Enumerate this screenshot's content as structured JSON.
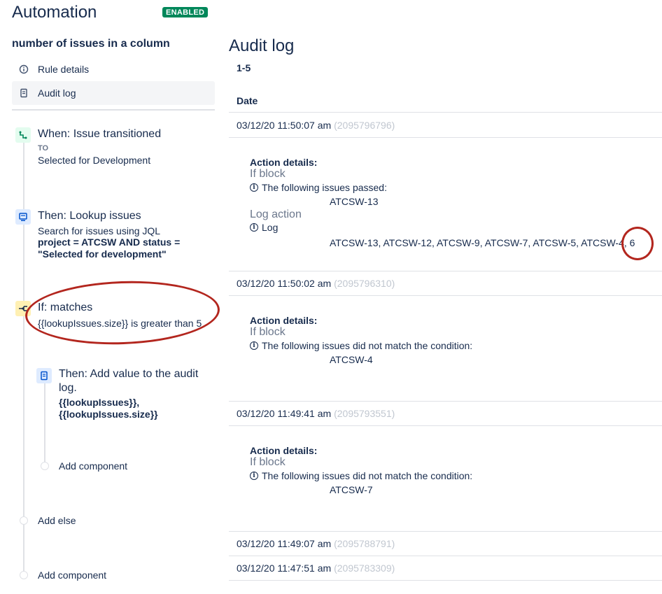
{
  "header": {
    "title": "Automation",
    "status_badge": "ENABLED"
  },
  "sidebar": {
    "rule_name": "number of issues in a column",
    "nav": [
      {
        "label": "Rule details",
        "icon": "info-icon"
      },
      {
        "label": "Audit log",
        "icon": "document-icon",
        "selected": true
      }
    ],
    "components": {
      "trigger": {
        "title": "When: Issue transitioned",
        "to_label": "TO",
        "to_value": "Selected for Development"
      },
      "lookup": {
        "title": "Then: Lookup issues",
        "sub": "Search for issues using JQL",
        "jql": "project = ATCSW AND status = \"Selected for development\""
      },
      "condition": {
        "title": "If: matches",
        "sub": "{{lookupIssues.size}} is greater than 5"
      },
      "log_action": {
        "title": "Then: Add value to the audit log.",
        "value": "{{lookupIssues}}, {{lookupIssues.size}}"
      },
      "add_component_inner": "Add component",
      "add_else": "Add else",
      "add_component_outer": "Add component"
    }
  },
  "main": {
    "title": "Audit log",
    "range": "1-5",
    "column_header": "Date",
    "entries": [
      {
        "date": "03/12/20 11:50:07 am",
        "id": "(2095796796)",
        "details_label": "Action details:",
        "blocks": [
          {
            "name": "If block",
            "message": "The following issues passed:",
            "value": "ATCSW-13"
          },
          {
            "name": "Log action",
            "message": "Log",
            "value": "ATCSW-13, ATCSW-12, ATCSW-9, ATCSW-7, ATCSW-5, ATCSW-4, 6"
          }
        ]
      },
      {
        "date": "03/12/20 11:50:02 am",
        "id": "(2095796310)",
        "details_label": "Action details:",
        "blocks": [
          {
            "name": "If block",
            "message": "The following issues did not match the condition:",
            "value": "ATCSW-4"
          }
        ]
      },
      {
        "date": "03/12/20 11:49:41 am",
        "id": "(2095793551)",
        "details_label": "Action details:",
        "blocks": [
          {
            "name": "If block",
            "message": "The following issues did not match the condition:",
            "value": "ATCSW-7"
          }
        ]
      },
      {
        "date": "03/12/20 11:49:07 am",
        "id": "(2095788791)"
      },
      {
        "date": "03/12/20 11:47:51 am",
        "id": "(2095783309)"
      }
    ]
  },
  "colors": {
    "accent": "#172b4d",
    "enabled": "#00875a",
    "annotation": "#b3261e",
    "muted": "#c1c7d0"
  }
}
